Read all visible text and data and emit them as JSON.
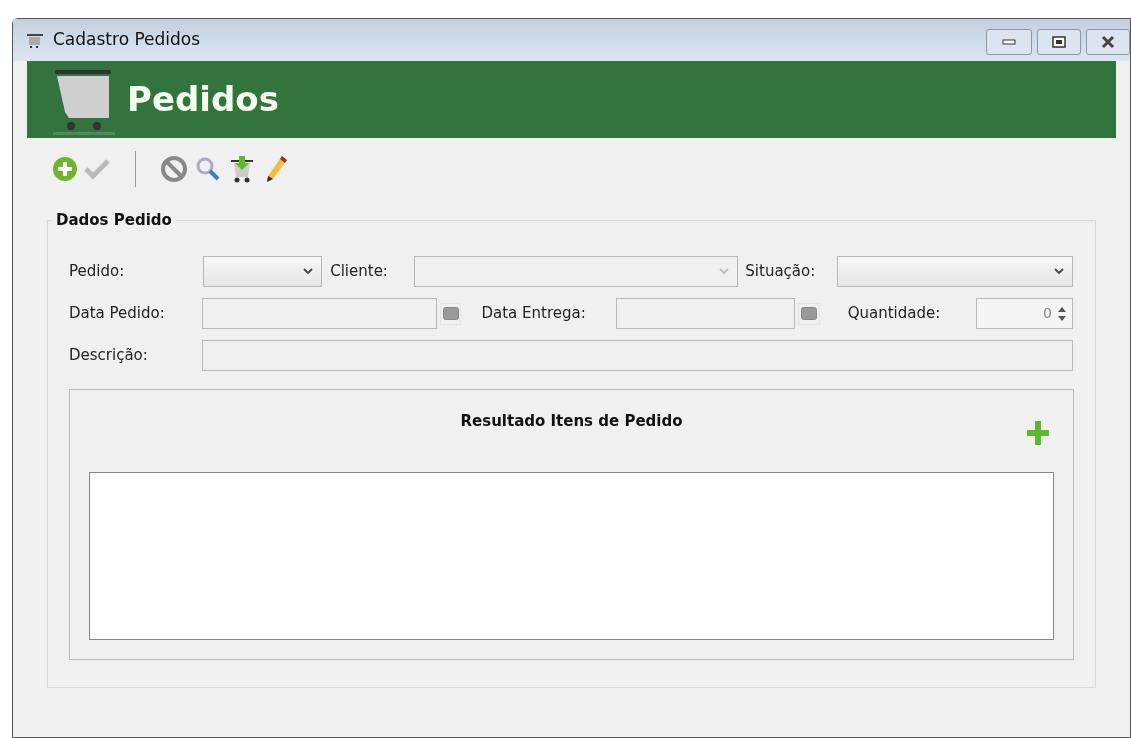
{
  "window": {
    "title": "Cadastro Pedidos"
  },
  "banner": {
    "title": "Pedidos"
  },
  "toolbar": [
    {
      "kind": "add",
      "disabled": false
    },
    {
      "kind": "confirm",
      "disabled": true
    },
    {
      "kind": "separator"
    },
    {
      "kind": "cancel",
      "disabled": false
    },
    {
      "kind": "search",
      "disabled": false
    },
    {
      "kind": "cart",
      "disabled": false
    },
    {
      "kind": "edit",
      "disabled": false
    }
  ],
  "group": {
    "title": "Dados Pedido",
    "row1": [
      {
        "label": "Pedido:",
        "disabled": false
      },
      {
        "label": "Cliente:",
        "disabled": true
      },
      {
        "label": "Situação:",
        "disabled": false
      }
    ],
    "row2": [
      {
        "label": "Data Pedido:",
        "kind": "date"
      },
      {
        "label": "Data Entrega:",
        "kind": "date"
      },
      {
        "label": "Quantidade:",
        "kind": "spin",
        "value": "0"
      }
    ],
    "description": {
      "label": "Descrição:"
    }
  },
  "items_panel": {
    "title": "Resultado Itens de Pedido"
  }
}
